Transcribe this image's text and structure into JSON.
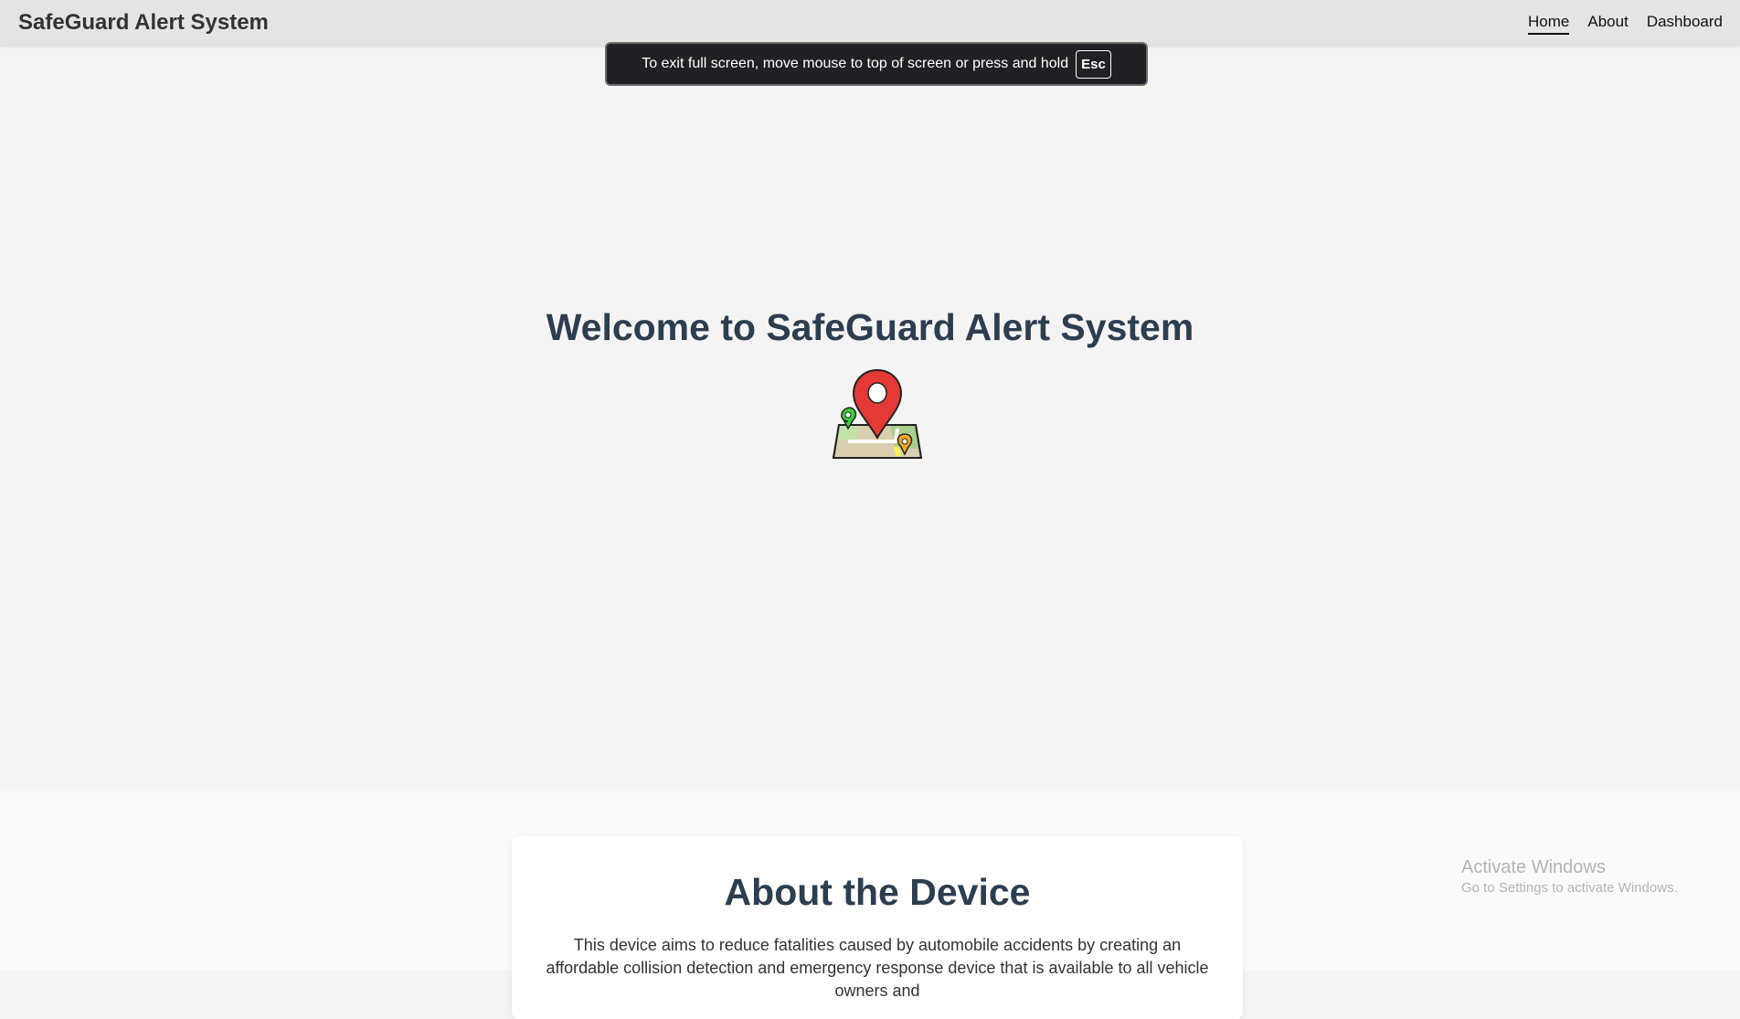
{
  "navbar": {
    "brand": "SafeGuard Alert System",
    "links": [
      {
        "label": "Home",
        "active": true
      },
      {
        "label": "About",
        "active": false
      },
      {
        "label": "Dashboard",
        "active": false
      }
    ]
  },
  "fullscreen_toast": {
    "message": "To exit full screen, move mouse to top of screen or press and hold",
    "key": "Esc"
  },
  "hero": {
    "title": "Welcome to SafeGuard Alert System",
    "icon": "map-pin-icon"
  },
  "about": {
    "title": "About the Device",
    "text": "This device aims to reduce fatalities caused by automobile accidents by creating an affordable collision detection and emergency response device that is available to all vehicle owners and"
  },
  "windows_watermark": {
    "title": "Activate Windows",
    "subtitle": "Go to Settings to activate Windows."
  },
  "colors": {
    "heading": "#2c3e50",
    "navbar_bg": "#e6e3e3",
    "page_bg": "#f4f4f4",
    "pin_red": "#e53935"
  }
}
